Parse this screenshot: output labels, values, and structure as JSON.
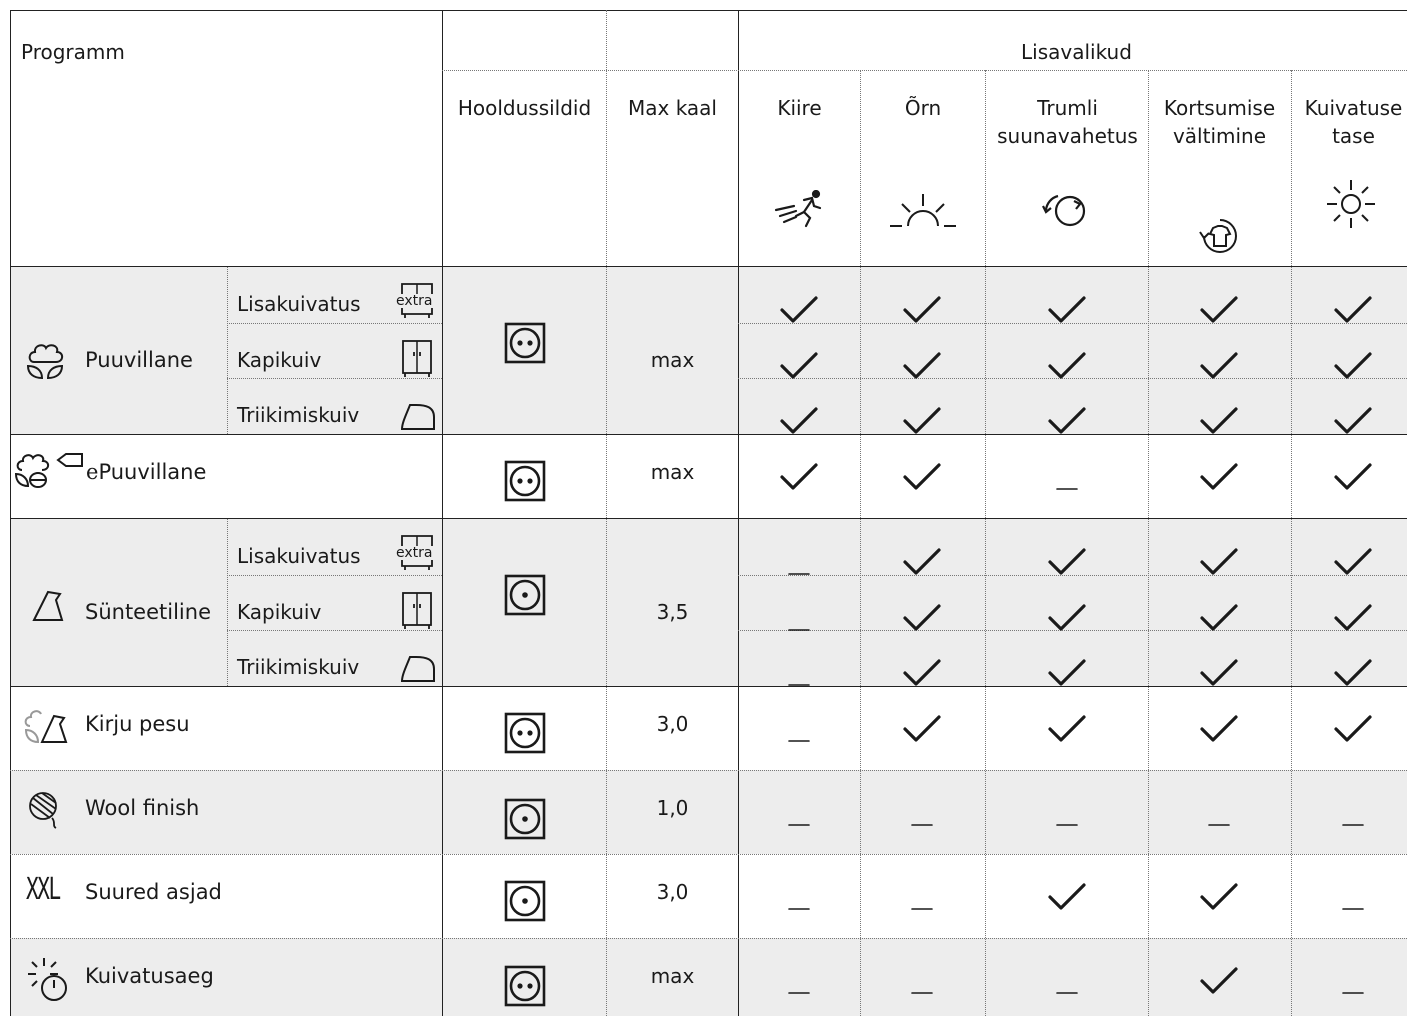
{
  "header": {
    "programm": "Programm",
    "lisavalikud": "Lisavalikud",
    "hooldussildid": "Hooldussildid",
    "max_kaal": "Max kaal",
    "options": [
      {
        "label": "Kiire",
        "icon": "running-person-icon"
      },
      {
        "label": "Õrn",
        "icon": "delicate-sunrise-icon"
      },
      {
        "label": "Trumli suunavahetus",
        "icon": "drum-reverse-icon"
      },
      {
        "label": "Kortsumise vältimine",
        "icon": "anti-crease-shirt-icon"
      },
      {
        "label": "Kuivatuse tase",
        "icon": "sun-dryness-icon"
      }
    ]
  },
  "programs": [
    {
      "name": "Puuvillane",
      "icon": "cotton-icon",
      "care": "tumble-dry-normal-icon",
      "max": "max",
      "sub": [
        {
          "label": "Lisakuivatus",
          "icon": "extra-dry-icon",
          "marks": [
            "check",
            "check",
            "check",
            "check",
            "check"
          ]
        },
        {
          "label": "Kapikuiv",
          "icon": "cupboard-dry-icon",
          "marks": [
            "check",
            "check",
            "check",
            "check",
            "check"
          ]
        },
        {
          "label": "Triikimiskuiv",
          "icon": "iron-dry-icon",
          "marks": [
            "check",
            "check",
            "check",
            "check",
            "check"
          ]
        }
      ]
    },
    {
      "name": "Puuvillane",
      "prefix": "e",
      "icon": "eco-cotton-icon",
      "care": "tumble-dry-normal-icon",
      "max": "max",
      "marks": [
        "check",
        "check",
        "dash",
        "check",
        "check"
      ]
    },
    {
      "name": "Sünteetiline",
      "icon": "synthetic-icon",
      "care": "tumble-dry-low-icon",
      "max": "3,5",
      "sub": [
        {
          "label": "Lisakuivatus",
          "icon": "extra-dry-icon",
          "marks": [
            "dash",
            "check",
            "check",
            "check",
            "check"
          ]
        },
        {
          "label": "Kapikuiv",
          "icon": "cupboard-dry-icon",
          "marks": [
            "dash",
            "check",
            "check",
            "check",
            "check"
          ]
        },
        {
          "label": "Triikimiskuiv",
          "icon": "iron-dry-icon",
          "marks": [
            "dash",
            "check",
            "check",
            "check",
            "check"
          ]
        }
      ]
    },
    {
      "name": "Kirju pesu",
      "icon": "mixed-icon",
      "care": "tumble-dry-normal-icon",
      "max": "3,0",
      "marks": [
        "dash",
        "check",
        "check",
        "check",
        "check"
      ]
    },
    {
      "name": "Wool finish",
      "icon": "wool-icon",
      "care": "tumble-dry-low-icon",
      "max": "1,0",
      "marks": [
        "dash",
        "dash",
        "dash",
        "dash",
        "dash"
      ]
    },
    {
      "name": "Suured asjad",
      "icon": "xxl-icon",
      "icon_text": "XXL",
      "care": "tumble-dry-low-icon",
      "max": "3,0",
      "marks": [
        "dash",
        "dash",
        "check",
        "check",
        "dash"
      ]
    },
    {
      "name": "Kuivatusaeg",
      "icon": "timed-dry-icon",
      "care": "tumble-dry-normal-icon",
      "max": "max",
      "marks": [
        "dash",
        "dash",
        "dash",
        "check",
        "dash"
      ]
    }
  ]
}
